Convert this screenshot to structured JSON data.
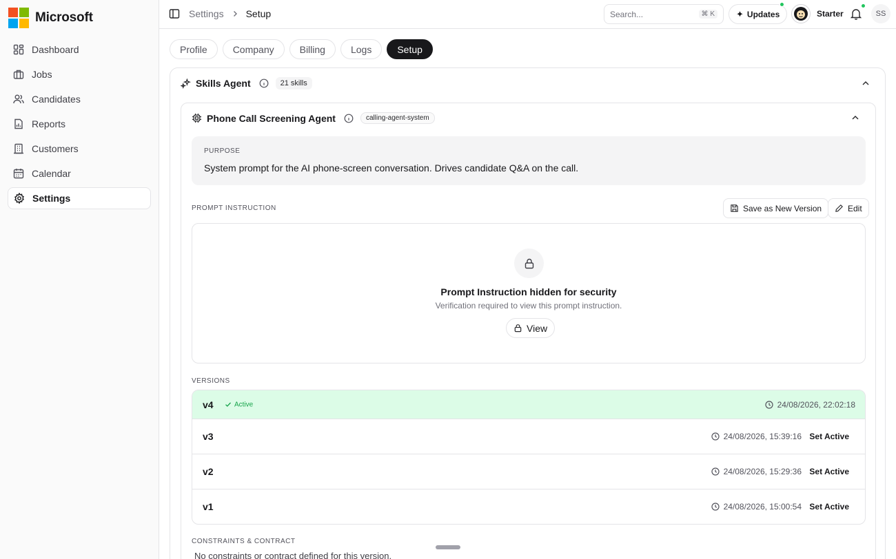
{
  "brand": {
    "name": "Microsoft",
    "logo_colors": [
      "#f25022",
      "#7fba00",
      "#00a4ef",
      "#ffb900"
    ]
  },
  "sidebar": {
    "items": [
      {
        "label": "Dashboard",
        "icon": "dashboard-icon"
      },
      {
        "label": "Jobs",
        "icon": "briefcase-icon"
      },
      {
        "label": "Candidates",
        "icon": "users-icon"
      },
      {
        "label": "Reports",
        "icon": "report-icon"
      },
      {
        "label": "Customers",
        "icon": "building-icon"
      },
      {
        "label": "Calendar",
        "icon": "calendar-icon"
      },
      {
        "label": "Settings",
        "icon": "gear-icon",
        "active": true
      }
    ]
  },
  "header": {
    "breadcrumb": [
      "Settings",
      "Setup"
    ],
    "search": {
      "placeholder": "Search...",
      "shortcut": "⌘ K"
    },
    "updates_label": "Updates",
    "plan": "Starter",
    "user_initials": "SS",
    "status_color": "#22c55e"
  },
  "tabs": [
    {
      "label": "Profile"
    },
    {
      "label": "Company"
    },
    {
      "label": "Billing"
    },
    {
      "label": "Logs"
    },
    {
      "label": "Setup",
      "active": true
    }
  ],
  "skills_agent": {
    "title": "Skills Agent",
    "count_badge": "21 skills",
    "agent": {
      "title": "Phone Call Screening Agent",
      "badge": "calling-agent-system",
      "purpose_label": "PURPOSE",
      "purpose_text": "System prompt for the AI phone-screen conversation. Drives candidate Q&A on the call.",
      "prompt_label": "PROMPT INSTRUCTION",
      "save_version_label": "Save as New Version",
      "edit_label": "Edit",
      "locked_title": "Prompt Instruction hidden for security",
      "locked_subtitle": "Verification required to view this prompt instruction.",
      "view_label": "View",
      "versions_label": "VERSIONS",
      "versions": [
        {
          "name": "v4",
          "status": "Active",
          "timestamp": "24/08/2026, 22:02:18"
        },
        {
          "name": "v3",
          "timestamp": "24/08/2026, 15:39:16",
          "action": "Set Active"
        },
        {
          "name": "v2",
          "timestamp": "24/08/2026, 15:29:36",
          "action": "Set Active"
        },
        {
          "name": "v1",
          "timestamp": "24/08/2026, 15:00:54",
          "action": "Set Active"
        }
      ],
      "constraints_label": "CONSTRAINTS & CONTRACT",
      "constraints_text": "No constraints or contract defined for this version."
    }
  },
  "colors": {
    "accent": "#18181b",
    "active_row": "#dcfce7",
    "active_text": "#16a34a"
  }
}
